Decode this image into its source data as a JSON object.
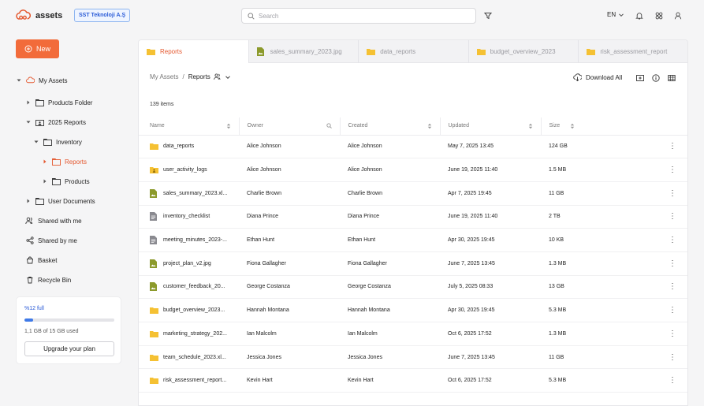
{
  "header": {
    "app_name": "assets",
    "org_badge": "SST Teknoloji A.Ş",
    "search_placeholder": "Search",
    "language": "EN"
  },
  "sidebar": {
    "new_label": "New",
    "tree": [
      {
        "label": "My Assets",
        "icon": "cloud-icon",
        "caret": "down"
      },
      {
        "label": "Products Folder",
        "icon": "folder-icon",
        "caret": "right"
      },
      {
        "label": "2025 Reports",
        "icon": "shared-folder-icon",
        "caret": "down"
      },
      {
        "label": "Inventory",
        "icon": "folder-icon",
        "caret": "down"
      },
      {
        "label": "Reports",
        "icon": "folder-icon",
        "caret": "right",
        "active": true
      },
      {
        "label": "Products",
        "icon": "folder-icon",
        "caret": "right"
      },
      {
        "label": "User Documents",
        "icon": "folder-icon",
        "caret": "right"
      }
    ],
    "nav": [
      {
        "label": "Shared with me",
        "icon": "users-icon"
      },
      {
        "label": "Shared by me",
        "icon": "share-icon"
      },
      {
        "label": "Basket",
        "icon": "basket-icon"
      },
      {
        "label": "Recycle Bin",
        "icon": "trash-icon"
      }
    ],
    "storage": {
      "percent_label": "%12 full",
      "fill_fraction": 0.1,
      "used_label": "1,1 GB of 15 GB used",
      "upgrade_label": "Upgrade your plan"
    }
  },
  "tabs": [
    {
      "label": "Reports",
      "icon": "folder-icon",
      "active": true
    },
    {
      "label": "sales_summary_2023.jpg",
      "icon": "image-file-icon",
      "active": false
    },
    {
      "label": "data_reports",
      "icon": "folder-icon",
      "active": false
    },
    {
      "label": "budget_overview_2023",
      "icon": "folder-icon",
      "active": false
    },
    {
      "label": "risk_assessment_report",
      "icon": "folder-icon",
      "active": false
    }
  ],
  "breadcrumb": {
    "root": "My Assets",
    "separator": "/",
    "current": "Reports"
  },
  "toolbar": {
    "download_label": "Download All"
  },
  "list": {
    "count_label": "139 items",
    "columns": [
      "Name",
      "Owner",
      "Created",
      "Updated",
      "Size"
    ],
    "rows": [
      {
        "name": "data_reports",
        "type": "folder",
        "owner": "Alice Johnson",
        "created": "Alice Johnson",
        "updated": "May 7, 2025 13:45",
        "size": "124 GB"
      },
      {
        "name": "user_activity_logs",
        "type": "shared-folder",
        "owner": "Alice Johnson",
        "created": "Alice Johnson",
        "updated": "June 19, 2025 11:40",
        "size": "1.5 MB"
      },
      {
        "name": "sales_summary_2023.xl...",
        "type": "image",
        "owner": "Charlie Brown",
        "created": "Charlie Brown",
        "updated": "Apr 7, 2025 19:45",
        "size": "11 GB"
      },
      {
        "name": "inventory_checklist",
        "type": "doc",
        "owner": "Diana Prince",
        "created": "Diana Prince",
        "updated": "June 19, 2025 11:40",
        "size": "2 TB"
      },
      {
        "name": "meeting_minutes_2023-...",
        "type": "doc",
        "owner": "Ethan Hunt",
        "created": "Ethan Hunt",
        "updated": "Apr 30, 2025 19:45",
        "size": "10 KB"
      },
      {
        "name": "project_plan_v2.jpg",
        "type": "image",
        "owner": "Fiona Gallagher",
        "created": "Fiona Gallagher",
        "updated": "June 7, 2025 13:45",
        "size": "1.3 MB"
      },
      {
        "name": "customer_feedback_20...",
        "type": "image",
        "owner": "George Costanza",
        "created": "George Costanza",
        "updated": "July 5, 2025 08:33",
        "size": "13 GB"
      },
      {
        "name": "budget_overview_2023...",
        "type": "folder",
        "owner": "Hannah Montana",
        "created": "Hannah Montana",
        "updated": "Apr 30, 2025 19:45",
        "size": "5.3 MB"
      },
      {
        "name": "marketing_strategy_202...",
        "type": "folder",
        "owner": "Ian Malcolm",
        "created": "Ian Malcolm",
        "updated": "Oct 6, 2025 17:52",
        "size": "1.3 MB"
      },
      {
        "name": "team_schedule_2023.xl...",
        "type": "folder",
        "owner": "Jessica Jones",
        "created": "Jessica Jones",
        "updated": "June 7, 2025 13:45",
        "size": "11 GB"
      },
      {
        "name": "risk_assessment_report...",
        "type": "folder",
        "owner": "Kevin Hart",
        "created": "Kevin Hart",
        "updated": "Oct 6, 2025 17:52",
        "size": "5.3 MB"
      }
    ]
  },
  "colors": {
    "accent": "#f26b3a",
    "active_text": "#e4572e",
    "folder": "#f5c133",
    "file_green": "#8c9a2c",
    "doc_gray": "#8a8a90",
    "link_blue": "#2a5bd7"
  }
}
